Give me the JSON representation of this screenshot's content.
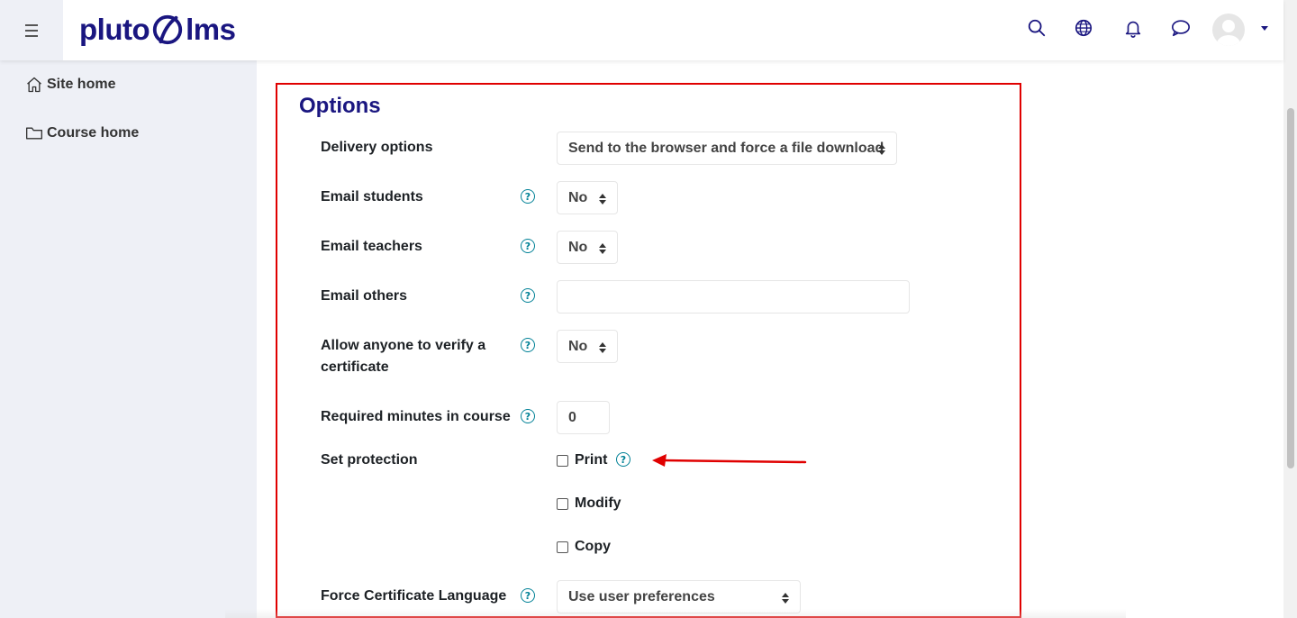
{
  "brand": {
    "name_left": "pluto",
    "name_right": "lms"
  },
  "nav": {
    "icons": [
      "search-icon",
      "globe-icon",
      "bell-icon",
      "chat-icon"
    ],
    "accent": "#1a1680"
  },
  "sidebar": {
    "items": [
      {
        "label": "Site home",
        "icon": "home-icon"
      },
      {
        "label": "Course home",
        "icon": "folder-icon"
      }
    ]
  },
  "options": {
    "title": "Options",
    "delivery": {
      "label": "Delivery options",
      "value": "Send to the browser and force a file download"
    },
    "email_students": {
      "label": "Email students",
      "value": "No"
    },
    "email_teachers": {
      "label": "Email teachers",
      "value": "No"
    },
    "email_others": {
      "label": "Email others",
      "value": ""
    },
    "verify": {
      "label": "Allow anyone to verify a certificate",
      "label_line1": "Allow anyone to verify a",
      "label_line2": "certificate",
      "value": "No"
    },
    "required_minutes": {
      "label": "Required minutes in course",
      "value": "0"
    },
    "protection": {
      "label": "Set protection",
      "items": [
        {
          "label": "Print",
          "checked": false
        },
        {
          "label": "Modify",
          "checked": false
        },
        {
          "label": "Copy",
          "checked": false
        }
      ]
    },
    "language": {
      "label": "Force Certificate Language",
      "value": "Use user preferences"
    }
  },
  "annotation": {
    "color": "#e00000"
  }
}
